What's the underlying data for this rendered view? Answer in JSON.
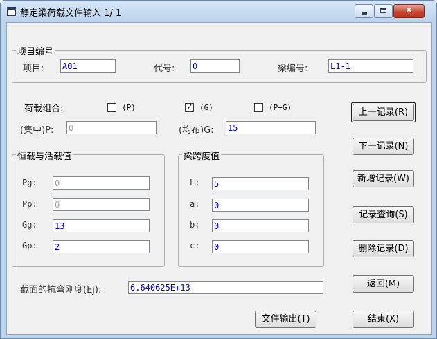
{
  "window": {
    "title": "静定梁荷载文件输入 1/ 1"
  },
  "project_group": {
    "title": "项目编号",
    "project_label": "项目:",
    "project_value": "A01",
    "code_label": "代号:",
    "code_value": "0",
    "beam_label": "梁编号:",
    "beam_value": "L1-1"
  },
  "load_combo": {
    "label": "荷载组合:",
    "options": [
      {
        "label": "(P)",
        "checked": false
      },
      {
        "label": "(G)",
        "checked": true
      },
      {
        "label": "(P+G)",
        "checked": false
      }
    ],
    "concentrated_label": "(集中)P:",
    "concentrated_value": "0",
    "distributed_label": "(均布)G:",
    "distributed_value": "15"
  },
  "dead_live_group": {
    "title": "恒载与活载值",
    "rows": [
      {
        "label": "Pg:",
        "value": "0",
        "enabled": false
      },
      {
        "label": "Pp:",
        "value": "0",
        "enabled": false
      },
      {
        "label": "Gg:",
        "value": "13",
        "enabled": true
      },
      {
        "label": "Gp:",
        "value": "2",
        "enabled": true
      }
    ]
  },
  "span_group": {
    "title": "梁跨度值",
    "rows": [
      {
        "label": "L:",
        "value": "5"
      },
      {
        "label": "a:",
        "value": "0"
      },
      {
        "label": "b:",
        "value": "0"
      },
      {
        "label": "c:",
        "value": "0"
      }
    ]
  },
  "stiffness": {
    "label": "截面的抗弯刚度(Ej):",
    "value": "6.640625E+13"
  },
  "buttons": {
    "prev": "上一记录(R)",
    "next": "下一记录(N)",
    "add": "新增记录(W)",
    "query": "记录查询(S)",
    "delete": "删除记录(D)",
    "back": "返回(M)",
    "export": "文件输出(T)",
    "end": "结束(X)"
  }
}
